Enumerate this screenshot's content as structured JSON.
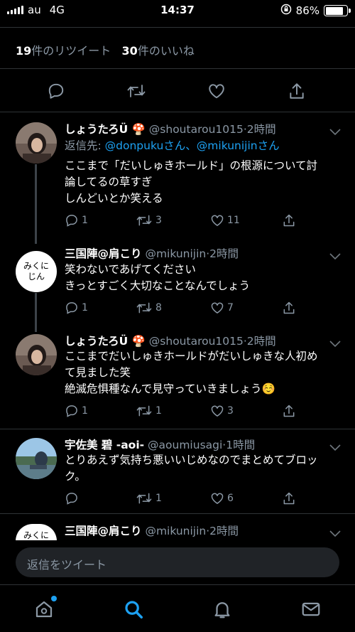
{
  "status_bar": {
    "carrier": "au",
    "network": "4G",
    "time": "14:37",
    "battery_percent": "86%",
    "battery_level": 0.86
  },
  "stats": {
    "retweets_count": "19",
    "retweets_label": "件のリツイート",
    "likes_count": "30",
    "likes_label": "件のいいね"
  },
  "main_actions": {
    "icons": [
      "reply-icon",
      "retweet-icon",
      "like-icon",
      "share-icon"
    ]
  },
  "replies": [
    {
      "name": "しょうたろÜ 🍄",
      "handle": "@shoutarou1015",
      "time": "·2時間",
      "reply_to_label": "返信先: ",
      "reply_to_mentions": "@donpukuさん、@mikunijinさん",
      "text_lines": [
        "ここまで「だいしゅきホールド」の根源について討",
        "論してるの草すぎ",
        "しんどいとか笑える"
      ],
      "replies": "1",
      "retweets": "3",
      "likes": "11"
    },
    {
      "name": "三国陣@肩こり",
      "handle": "@mikunijin",
      "time": "·2時間",
      "avatar_text": [
        "みくに",
        "じん"
      ],
      "text_lines": [
        "笑わないであげてください",
        "きっとすごく大切なことなんでしょう"
      ],
      "replies": "1",
      "retweets": "8",
      "likes": "7"
    },
    {
      "name": "しょうたろÜ 🍄",
      "handle": "@shoutarou1015",
      "time": "·2時間",
      "text_lines": [
        "ここまでだいしゅきホールドがだいしゅきな人初め",
        "て見ました笑",
        "絶滅危惧種なんで見守っていきましょう☺️"
      ],
      "replies": "1",
      "retweets": "1",
      "likes": "3"
    },
    {
      "name": "宇佐美 碧 -aoi-",
      "handle": "@aoumiusagi",
      "time": "·1時間",
      "text_lines": [
        "とりあえず気持ち悪いいじめなのでまとめてブロッ",
        "ク。"
      ],
      "replies": "",
      "retweets": "1",
      "likes": "6"
    },
    {
      "name": "三国陣@肩こり",
      "handle": "@mikunijin",
      "time": "·2時間",
      "avatar_text": [
        "みくに",
        "じん"
      ]
    }
  ],
  "reply_input": {
    "placeholder": "返信をツイート"
  },
  "tabbar": {
    "tabs": [
      "home-icon",
      "search-icon",
      "notifications-icon",
      "messages-icon"
    ],
    "active": "search-icon"
  },
  "colors": {
    "background": "#000000",
    "accent": "#1da1f2",
    "secondary_text": "#8b98a5",
    "divider": "#2f3336"
  }
}
